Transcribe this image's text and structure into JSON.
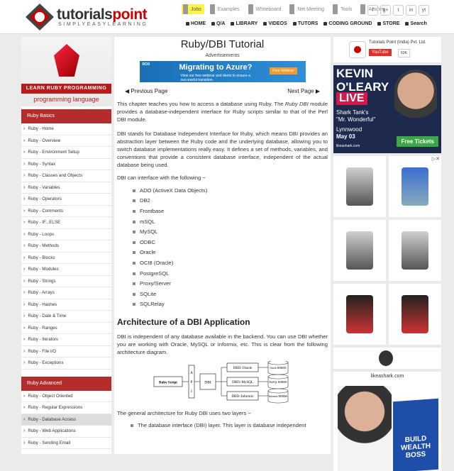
{
  "site": {
    "name_part1": "tutorials",
    "name_part2": "point",
    "tagline": "SIMPLYEASYLEARNING"
  },
  "toplinks": [
    "Jobs",
    "Examples",
    "Whiteboard",
    "Net Meeting",
    "Tools",
    "Articles"
  ],
  "social": [
    "f",
    "g+",
    "t",
    "in",
    "yt"
  ],
  "nav": [
    "HOME",
    "Q/A",
    "LIBRARY",
    "VIDEOS",
    "TUTORS",
    "CODING GROUND",
    "STORE",
    "Search"
  ],
  "sidebar": {
    "banner_learn": "LEARN RUBY PROGRAMMING",
    "banner_lang": "programming language",
    "basics_title": "Ruby Basics",
    "basics": [
      "Ruby - Home",
      "Ruby - Overview",
      "Ruby - Environment Setup",
      "Ruby - Syntax",
      "Ruby - Classes and Objects",
      "Ruby - Variables",
      "Ruby - Operators",
      "Ruby - Comments",
      "Ruby - IF...ELSE",
      "Ruby - Loops",
      "Ruby - Methods",
      "Ruby - Blocks",
      "Ruby - Modules",
      "Ruby - Strings",
      "Ruby - Arrays",
      "Ruby - Hashes",
      "Ruby - Date & Time",
      "Ruby - Ranges",
      "Ruby - Iterators",
      "Ruby - File I/O",
      "Ruby - Exceptions"
    ],
    "advanced_title": "Ruby Advanced",
    "advanced": [
      "Ruby - Object Oriented",
      "Ruby - Regular Expressions",
      "Ruby - Database Access",
      "Ruby - Web Applications",
      "Ruby - Sending Email"
    ]
  },
  "main": {
    "title": "Ruby/DBI Tutorial",
    "ads_label": "Advertisements",
    "ad_brand": "ROX",
    "ad_headline": "Migrating to Azure?",
    "ad_sub1": "View our free webinar and demo to ensure a",
    "ad_sub2": "successful transition.",
    "ad_button": "Free Webinar",
    "prev": "Previous Page",
    "next": "Next Page",
    "p1_pre": "This chapter teaches you how to access a database using Ruby. The ",
    "p1_em": "Ruby DBI",
    "p1_post": " module provides a database-independent interface for Ruby scripts similar to that of the Perl DBI module.",
    "p2": "DBI stands for Database Independent Interface for Ruby, which means DBI provides an abstraction layer between the Ruby code and the underlying database, allowing you to switch database implementations really easy. It defines a set of methods, variables, and conventions that provide a consistent database interface, independent of the actual database being used.",
    "p3": "DBI can interface with the following −",
    "dbs": [
      "ADO (ActiveX Data Objects)",
      "DB2",
      "Frontbase",
      "mSQL",
      "MySQL",
      "ODBC",
      "Oracle",
      "OCI8 (Oracle)",
      "PostgreSQL",
      "Proxy/Server",
      "SQLite",
      "SQLRelay"
    ],
    "h2": "Architecture of a DBI Application",
    "p4": "DBI is independent of any database available in the backend. You can use DBI whether you are working with Oracle, MySQL or Informix, etc. This is clear from the following architecture diagram.",
    "diagram": {
      "script": "Ruby Script",
      "api": [
        "A",
        "P",
        "I"
      ],
      "dbi": "DBI",
      "drivers": [
        "DBD::Oracle",
        "DBD::MySQL",
        "DBD::Informix"
      ],
      "dbs": [
        "Oracle RDBMS",
        "MySQL RDBMS",
        "Informix RDBMS"
      ]
    },
    "p5": "The general architecture for Ruby DBI uses two layers −",
    "layer1": "The database interface (DBI) layer. This layer is database independent"
  },
  "right": {
    "company": "Tutorials Point (India) Pvt. Ltd.",
    "youtube": "YouTube",
    "subs": "62K",
    "ad1": {
      "name": "KEVIN O'LEARY",
      "live": "LIVE",
      "sub1": "Shark Tank's",
      "sub2": "\"Mr. Wonderful\"",
      "city": "Lynnwood",
      "date": "May 03",
      "site": "likeashark.com",
      "btn": "Free Tickets"
    },
    "ad2": {
      "site": "likeashark.com",
      "book1": "BUILD WEALTH",
      "book2": "BOSS"
    }
  }
}
